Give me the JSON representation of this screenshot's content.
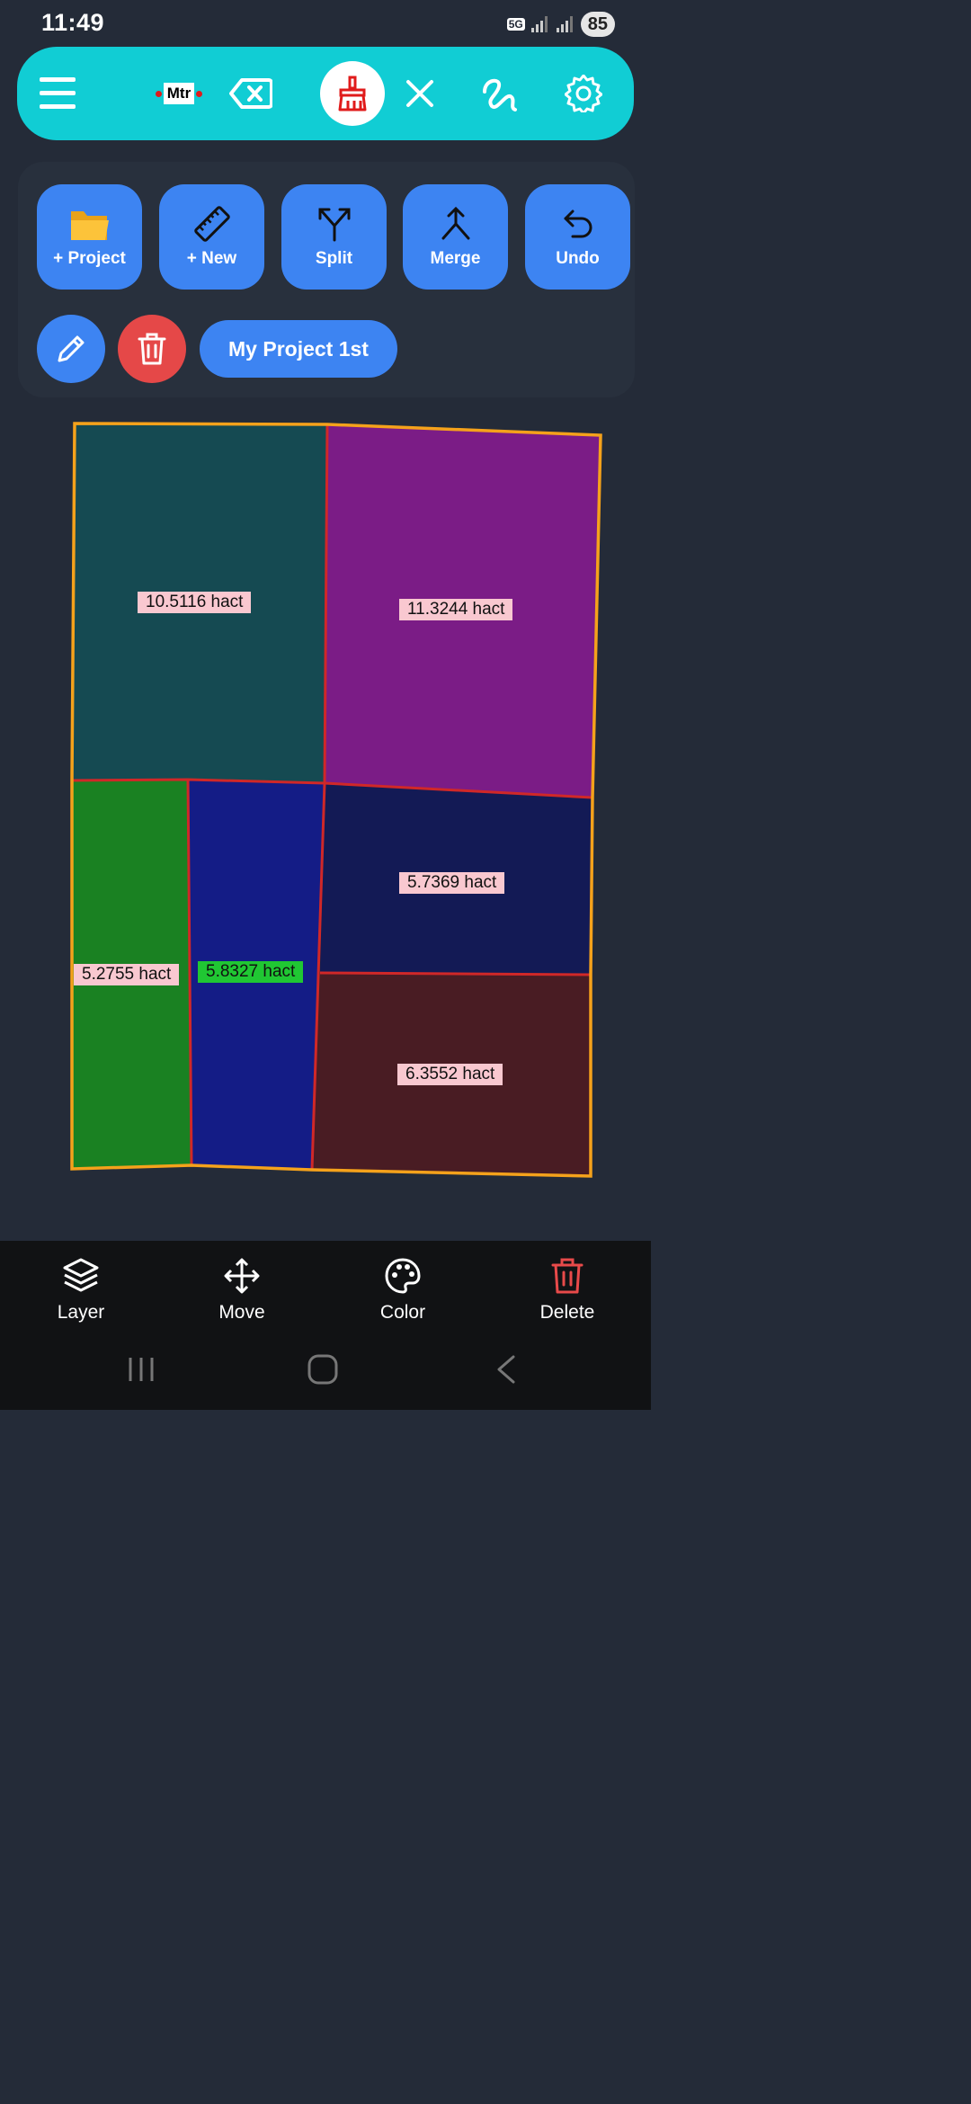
{
  "status_bar": {
    "time": "11:49",
    "network": "5G",
    "battery": "85"
  },
  "toolbar": {
    "unit_label": "Mtr",
    "icons": [
      "menu-icon",
      "backspace-icon",
      "brush-icon",
      "close-icon",
      "draw-path-icon",
      "gear-icon"
    ],
    "accent": "#11cdd4"
  },
  "actions": {
    "project_label": "+ Project",
    "new_label": "+ New",
    "split_label": "Split",
    "merge_label": "Merge",
    "undo_label": "Undo",
    "current_project": "My Project 1st"
  },
  "plots": [
    {
      "area": "10.5116 hact",
      "color": "#154a52"
    },
    {
      "area": "11.3244 hact",
      "color": "#7b1c86"
    },
    {
      "area": "5.2755 hact",
      "color": "#1a8122"
    },
    {
      "area": "5.8327 hact",
      "color": "#141c86",
      "selected": true
    },
    {
      "area": "5.7369 hact",
      "color": "#131a55"
    },
    {
      "area": "6.3552 hact",
      "color": "#491c23"
    }
  ],
  "bottom_bar": {
    "layer_label": "Layer",
    "move_label": "Move",
    "color_label": "Color",
    "delete_label": "Delete"
  }
}
